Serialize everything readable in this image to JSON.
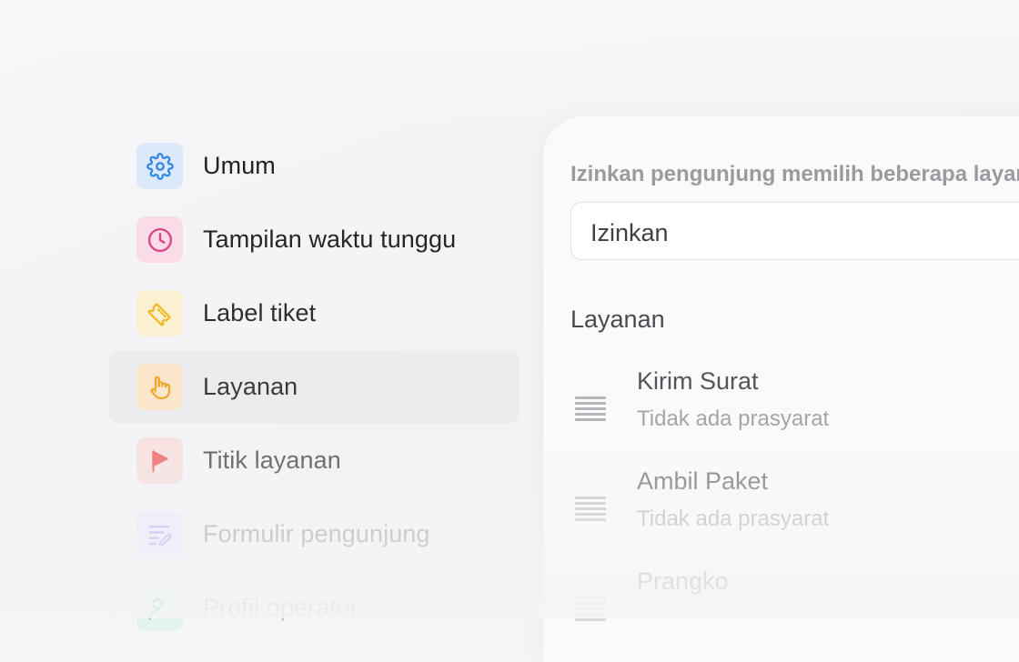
{
  "colors": {
    "umum_bg": "#dbe9fb",
    "umum_fg": "#2f86e6",
    "tampilan_bg": "#fadbe6",
    "tampilan_fg": "#dd3f86",
    "label_bg": "#fcf0d2",
    "label_fg": "#f0b91d",
    "layanan_bg": "#f9e6cb",
    "layanan_fg": "#f2a72a",
    "titik_bg": "#f8e0e0",
    "titik_fg": "#ee6f6f",
    "formulir_bg": "#ece8fa",
    "formulir_fg": "#b7a7ee",
    "profil_bg": "#e5f3f0",
    "profil_fg": "#7cc8ba"
  },
  "sidebar": {
    "items": [
      {
        "label": "Umum",
        "icon": "gear-icon",
        "active": false
      },
      {
        "label": "Tampilan waktu tunggu",
        "icon": "clock-icon",
        "active": false
      },
      {
        "label": "Label tiket",
        "icon": "ticket-icon",
        "active": false
      },
      {
        "label": "Layanan",
        "icon": "hand-pointer-icon",
        "active": true
      },
      {
        "label": "Titik layanan",
        "icon": "flag-icon",
        "active": false
      },
      {
        "label": "Formulir pengunjung",
        "icon": "form-edit-icon",
        "active": false
      },
      {
        "label": "Profil operator",
        "icon": "user-search-icon",
        "active": false
      }
    ]
  },
  "main": {
    "field_label": "Izinkan pengunjung memilih beberapa layanan",
    "select_value": "Izinkan",
    "section_title": "Layanan",
    "services": [
      {
        "name": "Kirim Surat",
        "subtitle": "Tidak ada prasyarat"
      },
      {
        "name": "Ambil Paket",
        "subtitle": "Tidak ada prasyarat"
      },
      {
        "name": "Prangko",
        "subtitle": ""
      }
    ]
  }
}
